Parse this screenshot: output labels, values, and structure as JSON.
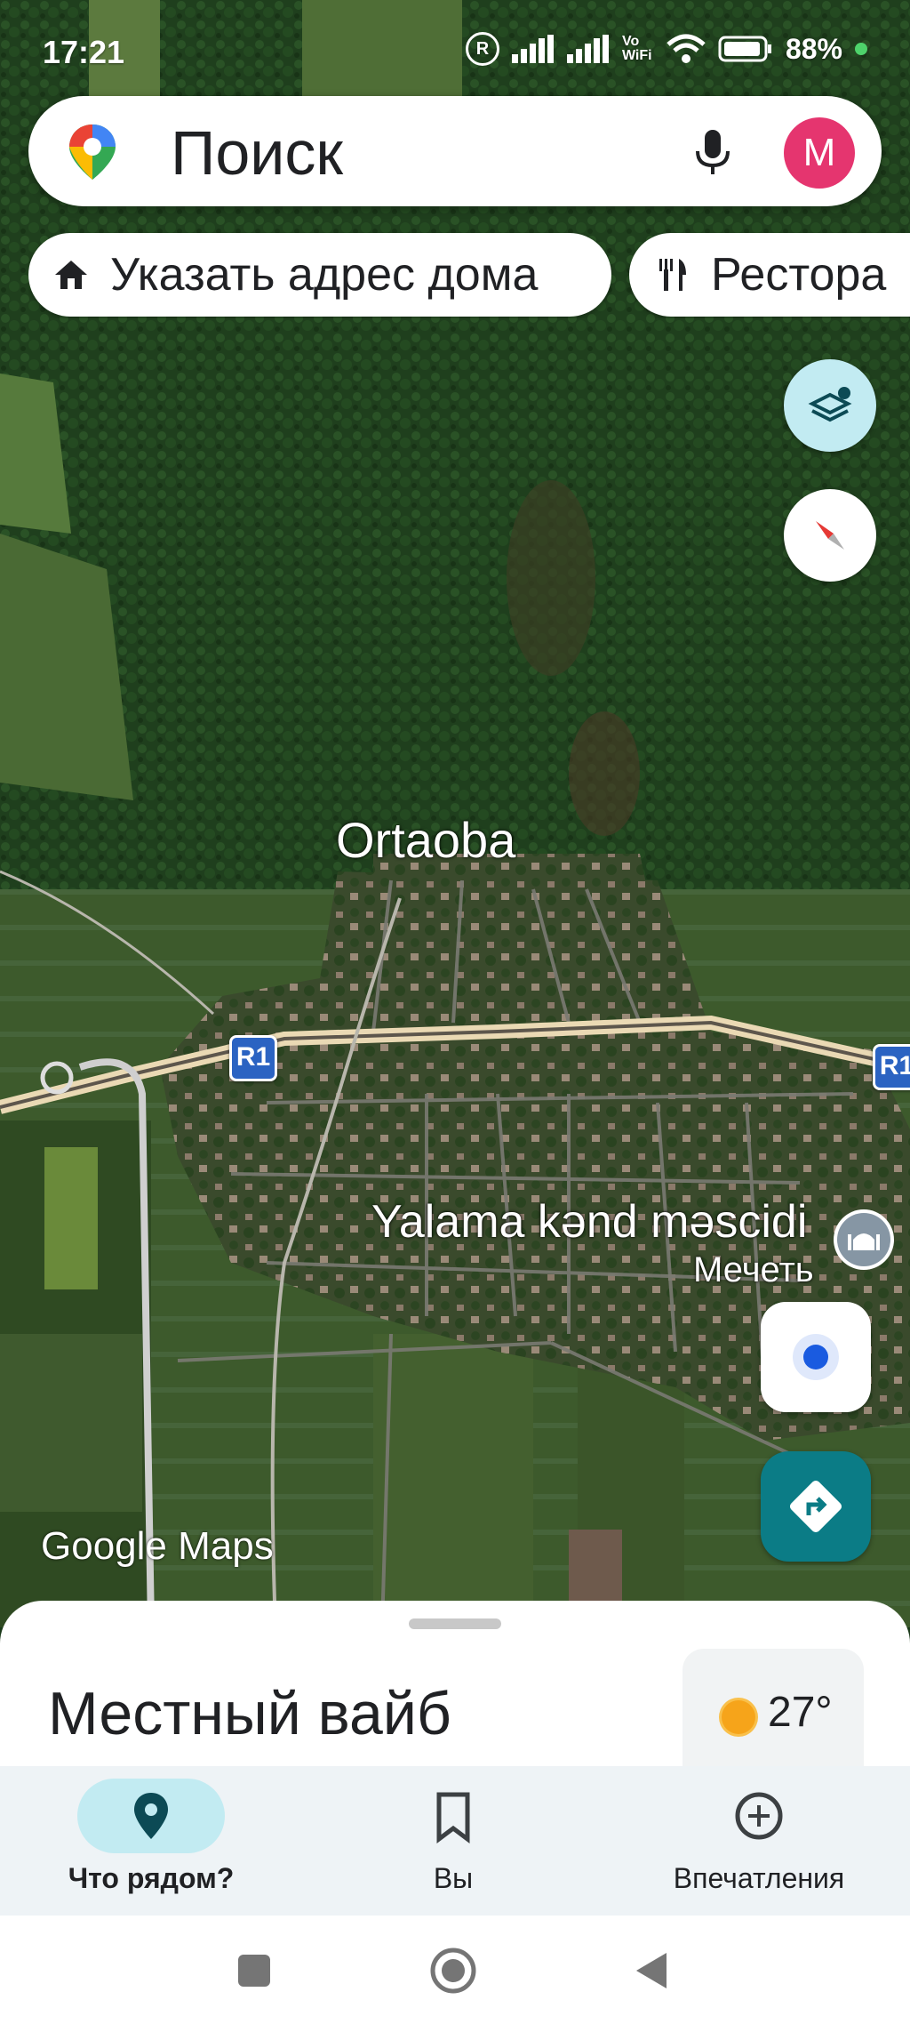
{
  "status_bar": {
    "time": "17:21",
    "battery": "88%"
  },
  "search": {
    "placeholder": "Поиск",
    "avatar_letter": "M"
  },
  "chips": [
    {
      "label": "Указать адрес дома",
      "icon": "home-icon"
    },
    {
      "label": "Рестора",
      "icon": "restaurant-icon"
    }
  ],
  "map": {
    "labels": {
      "village": "Ortaoba",
      "place_name": "Yalama kənd məscidi",
      "place_type": "Мечеть"
    },
    "road_shields": [
      "R1",
      "R1"
    ],
    "watermark": "Google Maps"
  },
  "sheet": {
    "title": "Местный вайб",
    "weather_temp": "27°"
  },
  "bottom_nav": [
    {
      "label": "Что рядом?",
      "icon": "location-pin-icon",
      "active": true
    },
    {
      "label": "Вы",
      "icon": "bookmark-icon",
      "active": false
    },
    {
      "label": "Впечатления",
      "icon": "add-circle-icon",
      "active": false
    }
  ],
  "colors": {
    "forest": "#1e3d1c",
    "road": "#d9c9a8",
    "accent_teal": "#0b7c86",
    "avatar": "#e5356f",
    "nav_active": "#c2ebf2"
  }
}
